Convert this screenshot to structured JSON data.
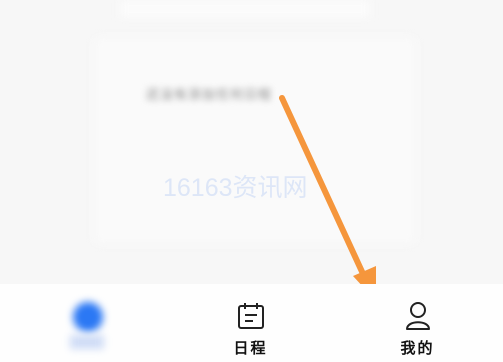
{
  "content": {
    "blurred_message": "还没有添加任何日程",
    "watermark": "16163资讯网"
  },
  "tabbar": {
    "tabs": [
      {
        "label": "",
        "icon": "home-icon"
      },
      {
        "label": "日程",
        "icon": "calendar-icon"
      },
      {
        "label": "我的",
        "icon": "user-icon"
      }
    ]
  },
  "annotation": {
    "arrow_color": "#f5963c"
  }
}
